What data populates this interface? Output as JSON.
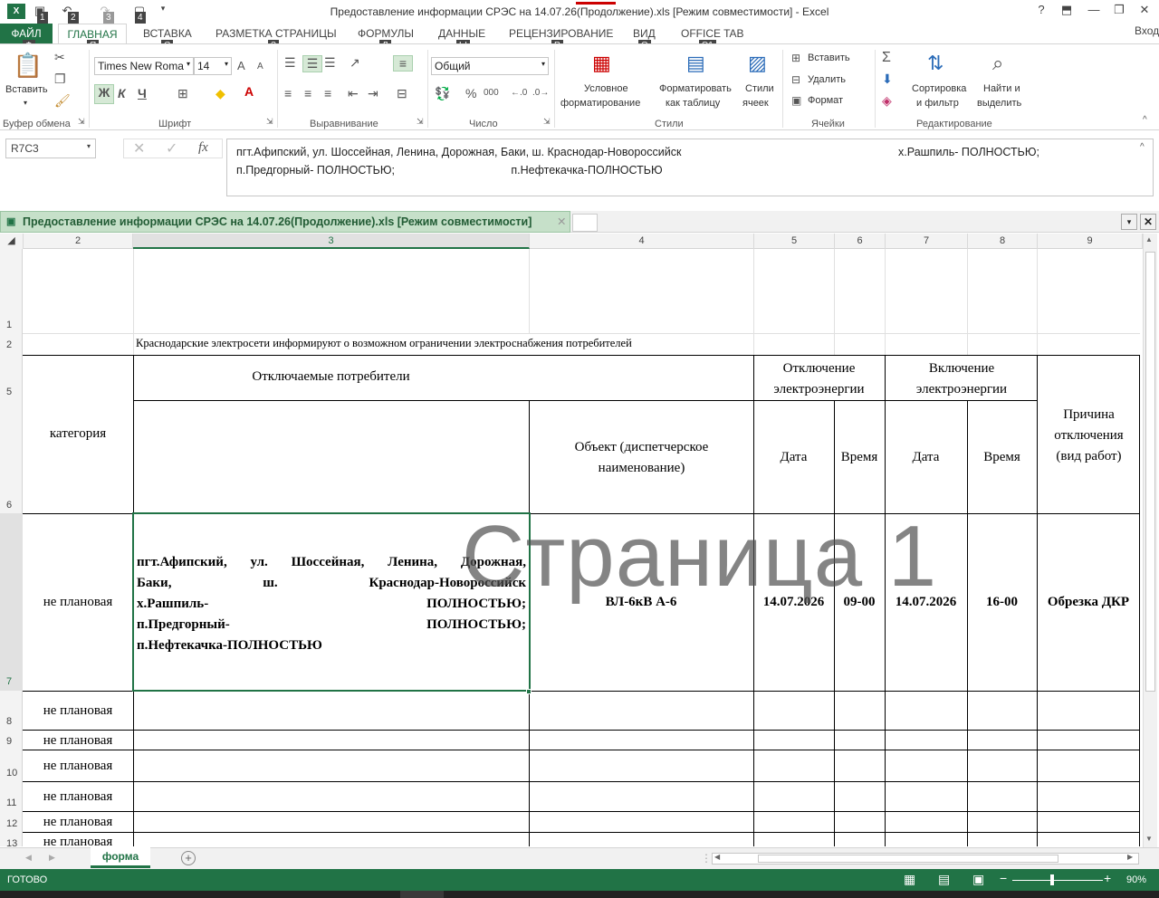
{
  "window": {
    "title": "Предоставление информации СРЭС на 14.07.26(Продолжение).xls  [Режим совместимости] - Excel",
    "help": "?",
    "minimize": "—",
    "restore": "❐",
    "close": "✕"
  },
  "quick_access": {
    "keytips": [
      "1",
      "2",
      "3",
      "4"
    ]
  },
  "tabs": {
    "file": "ФАЙЛ",
    "home": "ГЛАВНАЯ",
    "insert": "ВСТАВКА",
    "page_layout": "РАЗМЕТКА СТРАНИЦЫ",
    "formulas": "ФОРМУЛЫ",
    "data": "ДАННЫЕ",
    "review": "РЕЦЕНЗИРОВАНИЕ",
    "view": "ВИД",
    "office_tab": "OFFICE TAB",
    "signin": "Вход",
    "keytips": {
      "file": "Ф",
      "home": "Я",
      "insert": "С",
      "page_layout": "З",
      "formulas": "Л",
      "data": "Ы",
      "review": "Р",
      "view": "О",
      "office_tab": "Э1"
    }
  },
  "ribbon": {
    "clipboard": {
      "paste": "Вставить",
      "group": "Буфер обмена"
    },
    "font": {
      "name": "Times New Roma",
      "size": "14",
      "bold": "Ж",
      "italic": "К",
      "underline": "Ч",
      "grow": "A",
      "shrink": "A",
      "group": "Шрифт"
    },
    "alignment": {
      "group": "Выравнивание"
    },
    "number": {
      "format": "Общий",
      "percent": "%",
      "thousands": "000",
      "group": "Число"
    },
    "styles": {
      "conditional": "Условное",
      "conditional2": "форматирование",
      "format_table": "Форматировать",
      "format_table2": "как таблицу",
      "cell_styles": "Стили",
      "cell_styles2": "ячеек",
      "group": "Стили"
    },
    "cells": {
      "insert": "Вставить",
      "delete": "Удалить",
      "format": "Формат",
      "group": "Ячейки"
    },
    "editing": {
      "sort": "Сортировка",
      "sort2": "и фильтр",
      "find": "Найти и",
      "find2": "выделить",
      "group": "Редактирование"
    }
  },
  "formula_bar": {
    "name_box": "R7C3",
    "fx": "fx",
    "content": "пгт.Афипский, ул. Шоссейная, Ленина, Дорожная, Баки, ш. Краснодар-Новороссийск                                                                     х.Рашпиль- ПОЛНОСТЬЮ;\nп.Предгорный- ПОЛНОСТЬЮ;                                     п.Нефтекачка-ПОЛНОСТЬЮ"
  },
  "doc_tab": {
    "title": "Предоставление информации СРЭС на 14.07.26(Продолжение).xls  [Режим совместимости]"
  },
  "columns": [
    "2",
    "3",
    "4",
    "5",
    "6",
    "7",
    "8",
    "9"
  ],
  "rows": [
    "1",
    "2",
    "5",
    "6",
    "7",
    "8",
    "9",
    "10",
    "11",
    "12",
    "13"
  ],
  "sheet": {
    "heading": "Краснодарские электросети информируют о возможном ограничении электроснабжения потребителей",
    "h_consumers": "Отключаемые потребители",
    "h_off": "Отключение электроэнергии",
    "h_on": "Включение электроэнергии",
    "h_category": "категория",
    "h_object": "Объект (диспетчерское наименование)",
    "h_date1": "Дата",
    "h_time1": "Время",
    "h_date2": "Дата",
    "h_time2": "Время",
    "h_reason": "Причина отключения (вид работ)",
    "r7": {
      "category": "не плановая",
      "addr1": "пгт.Афипский, ул. Шоссейная, Ленина, Дорожная,",
      "addr2": "Баки, ш. Краснодар-Новороссийск",
      "addr3": "х.Рашпиль- ПОЛНОСТЬЮ;",
      "addr4": "п.Предгорный- ПОЛНОСТЬЮ;",
      "addr5": "п.Нефтекачка-ПОЛНОСТЬЮ",
      "object": "ВЛ-6кВ А-6",
      "date1": "14.07.2026",
      "time1": "09-00",
      "date2": "14.07.2026",
      "time2": "16-00",
      "reason": "Обрезка ДКР"
    },
    "other_category": "не плановая",
    "watermark": "Страница 1"
  },
  "sheet_tab": {
    "name": "форма"
  },
  "status": {
    "ready": "ГОТОВО",
    "zoom": "90%"
  },
  "colors": {
    "excel_green": "#217346",
    "tab_green": "#c6e0c9"
  }
}
